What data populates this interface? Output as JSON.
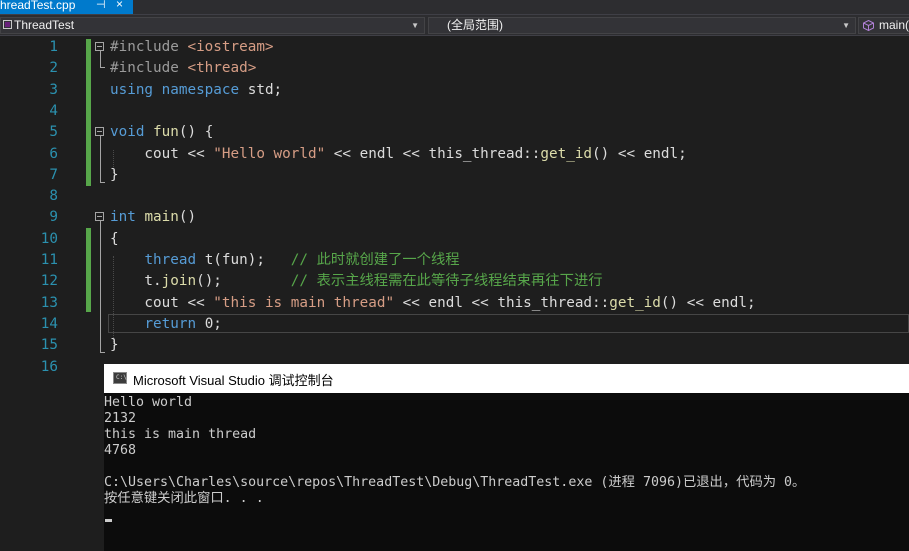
{
  "tab": {
    "title": "hreadTest.cpp",
    "pin": "⊣",
    "close": "×"
  },
  "navbar": {
    "project": "ThreadTest",
    "scope": "(全局范围)",
    "member": "main()"
  },
  "editor": {
    "lines": [
      {
        "n": "1",
        "segs": [
          {
            "c": "pp",
            "t": "#include "
          },
          {
            "c": "inc",
            "t": "<iostream>"
          }
        ]
      },
      {
        "n": "2",
        "segs": [
          {
            "c": "pp",
            "t": "#include "
          },
          {
            "c": "inc",
            "t": "<thread>"
          }
        ]
      },
      {
        "n": "3",
        "segs": [
          {
            "c": "kw",
            "t": "using namespace"
          },
          {
            "c": "",
            "t": " std;"
          }
        ]
      },
      {
        "n": "4",
        "segs": []
      },
      {
        "n": "5",
        "segs": [
          {
            "c": "kw",
            "t": "void"
          },
          {
            "c": "",
            "t": " "
          },
          {
            "c": "fn",
            "t": "fun"
          },
          {
            "c": "",
            "t": "() {"
          }
        ]
      },
      {
        "n": "6",
        "segs": [
          {
            "c": "",
            "t": "    cout << "
          },
          {
            "c": "str",
            "t": "\"Hello world\""
          },
          {
            "c": "",
            "t": " << endl << this_thread::"
          },
          {
            "c": "fn",
            "t": "get_id"
          },
          {
            "c": "",
            "t": "() << endl;"
          }
        ]
      },
      {
        "n": "7",
        "segs": [
          {
            "c": "",
            "t": "}"
          }
        ]
      },
      {
        "n": "8",
        "segs": []
      },
      {
        "n": "9",
        "segs": [
          {
            "c": "kw",
            "t": "int"
          },
          {
            "c": "",
            "t": " "
          },
          {
            "c": "fn",
            "t": "main"
          },
          {
            "c": "",
            "t": "()"
          }
        ]
      },
      {
        "n": "10",
        "segs": [
          {
            "c": "",
            "t": "{"
          }
        ]
      },
      {
        "n": "11",
        "segs": [
          {
            "c": "",
            "t": "    "
          },
          {
            "c": "kw",
            "t": "thread"
          },
          {
            "c": "",
            "t": " t(fun);   "
          },
          {
            "c": "cmt",
            "t": "// 此时就创建了一个线程"
          }
        ]
      },
      {
        "n": "12",
        "segs": [
          {
            "c": "",
            "t": "    t."
          },
          {
            "c": "fn",
            "t": "join"
          },
          {
            "c": "",
            "t": "();        "
          },
          {
            "c": "cmt",
            "t": "// 表示主线程需在此等待子线程结束再往下进行"
          }
        ]
      },
      {
        "n": "13",
        "segs": [
          {
            "c": "",
            "t": "    cout << "
          },
          {
            "c": "str",
            "t": "\"this is main thread\""
          },
          {
            "c": "",
            "t": " << endl << this_thread::"
          },
          {
            "c": "fn",
            "t": "get_id"
          },
          {
            "c": "",
            "t": "() << endl;"
          }
        ]
      },
      {
        "n": "14",
        "segs": [
          {
            "c": "",
            "t": "    "
          },
          {
            "c": "kw",
            "t": "return"
          },
          {
            "c": "",
            "t": " 0;"
          }
        ]
      },
      {
        "n": "15",
        "segs": [
          {
            "c": "",
            "t": "}"
          }
        ]
      },
      {
        "n": "16",
        "segs": []
      }
    ]
  },
  "console": {
    "title": "Microsoft Visual Studio 调试控制台",
    "icon_text": "C:\\",
    "lines": [
      "Hello world",
      "2132",
      "this is main thread",
      "4768",
      "",
      "C:\\Users\\Charles\\source\\repos\\ThreadTest\\Debug\\ThreadTest.exe (进程 7096)已退出，代码为 0。",
      "按任意键关闭此窗口. . ."
    ]
  },
  "colors": {
    "keyword": "#569cd6",
    "string": "#d69d85",
    "comment": "#57a64a",
    "line_number": "#2b91af",
    "tab_active": "#007acc"
  }
}
